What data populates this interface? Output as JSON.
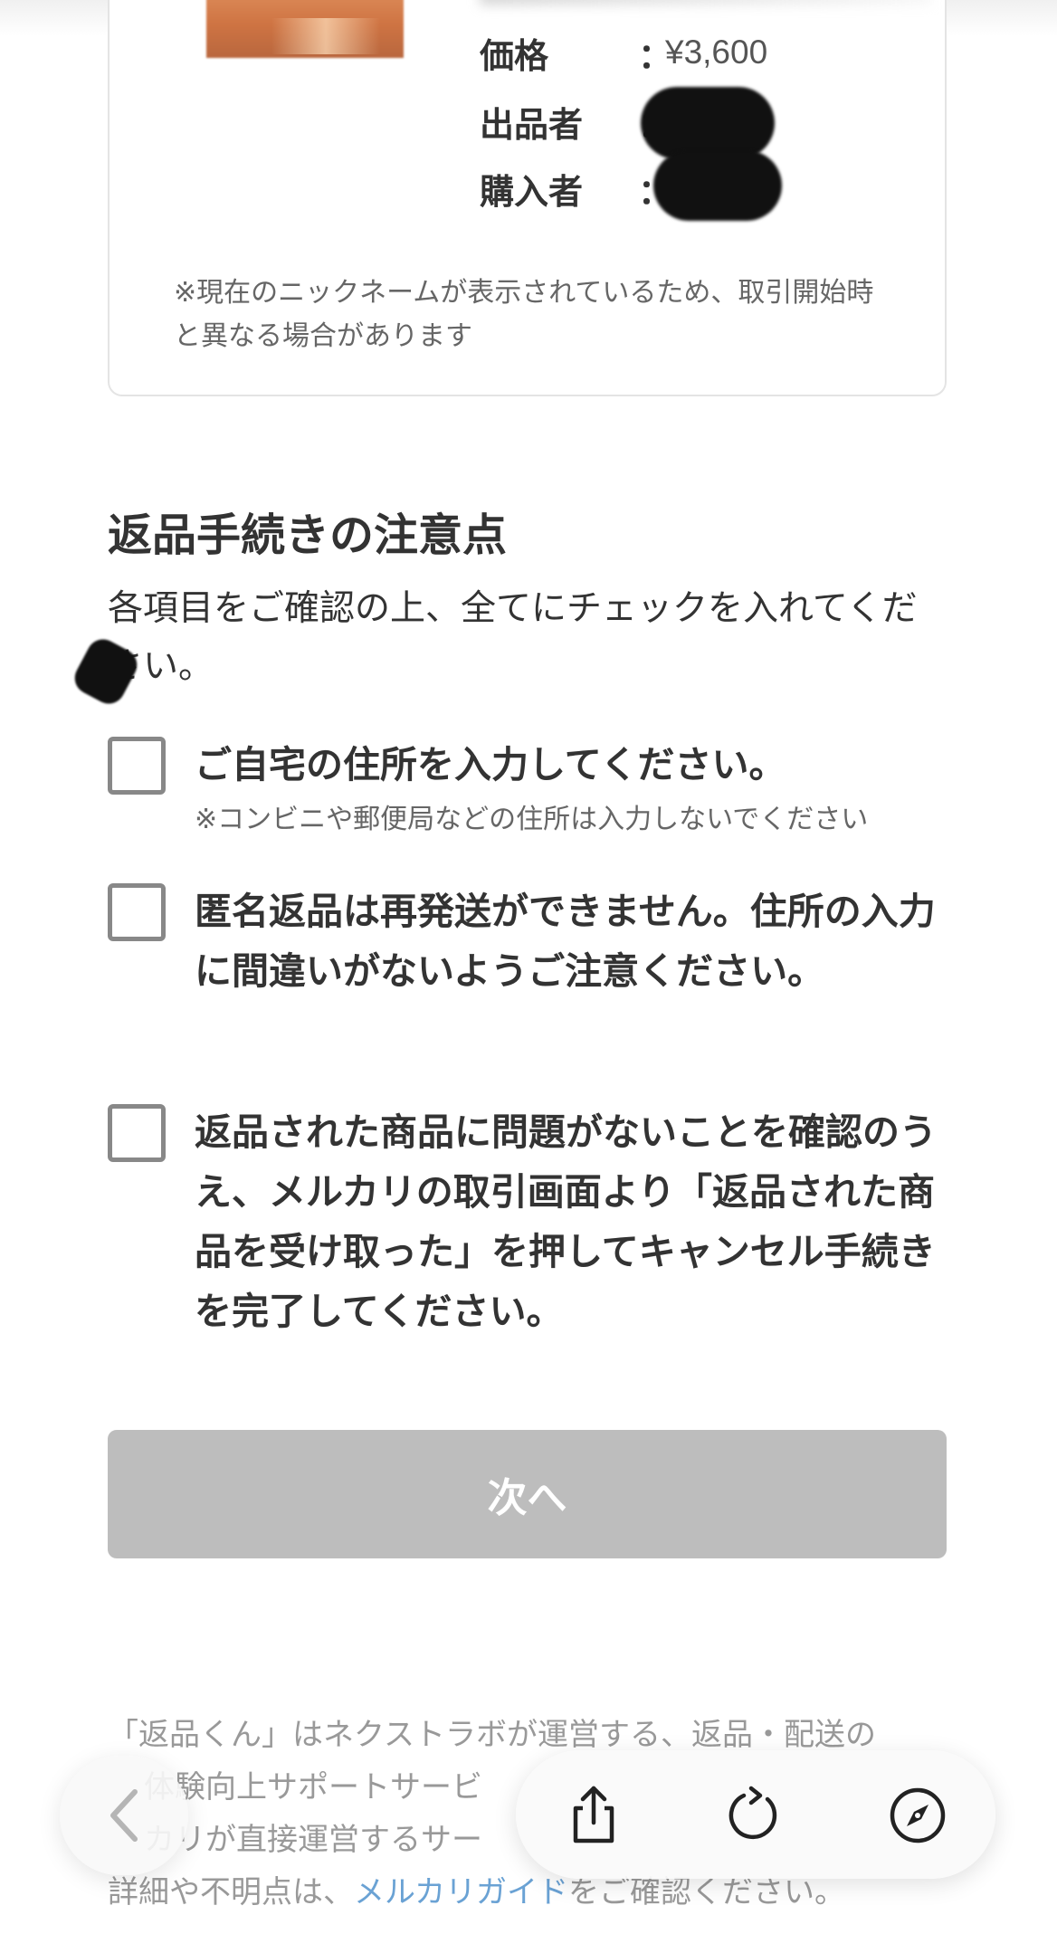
{
  "product": {
    "price_label": "価格",
    "price_value": "¥3,600",
    "seller_label": "出品者",
    "buyer_label": "購入者",
    "colon": "：",
    "nickname_note": "※現在のニックネームが表示されているため、取引開始時と異なる場合があります"
  },
  "checklist": {
    "title": "返品手続きの注意点",
    "description": "各項目をご確認の上、全てにチェックを入れてください。",
    "items": [
      {
        "label": "ご自宅の住所を入力してください。",
        "sub": "※コンビニや郵便局などの住所は入力しないでください",
        "checked": false
      },
      {
        "label": "匿名返品は再発送ができません。住所の入力に間違いがないようご注意ください。",
        "checked": false
      },
      {
        "label": "返品された商品に問題がないことを確認のうえ、メルカリの取引画面より「返品された商品を受け取った」を押してキャンセル手続きを完了してください。",
        "checked": false
      }
    ],
    "next_button": "次へ"
  },
  "footer": {
    "line1": "「返品くん」はネクストラボが運営する、返品・配送の",
    "line2": "体験向上サポートサービ",
    "line3": "カリが直接運営するサー",
    "line4_before": "詳細や不明点は、",
    "link": "メルカリガイド",
    "line4_after": "をご確認ください。"
  },
  "toolbar": {
    "icons": [
      "back-icon",
      "share-icon",
      "reload-icon",
      "compass-icon"
    ]
  },
  "colors": {
    "button_disabled": "#bdbdbd",
    "text": "#333333",
    "link": "#6aa2d4"
  }
}
